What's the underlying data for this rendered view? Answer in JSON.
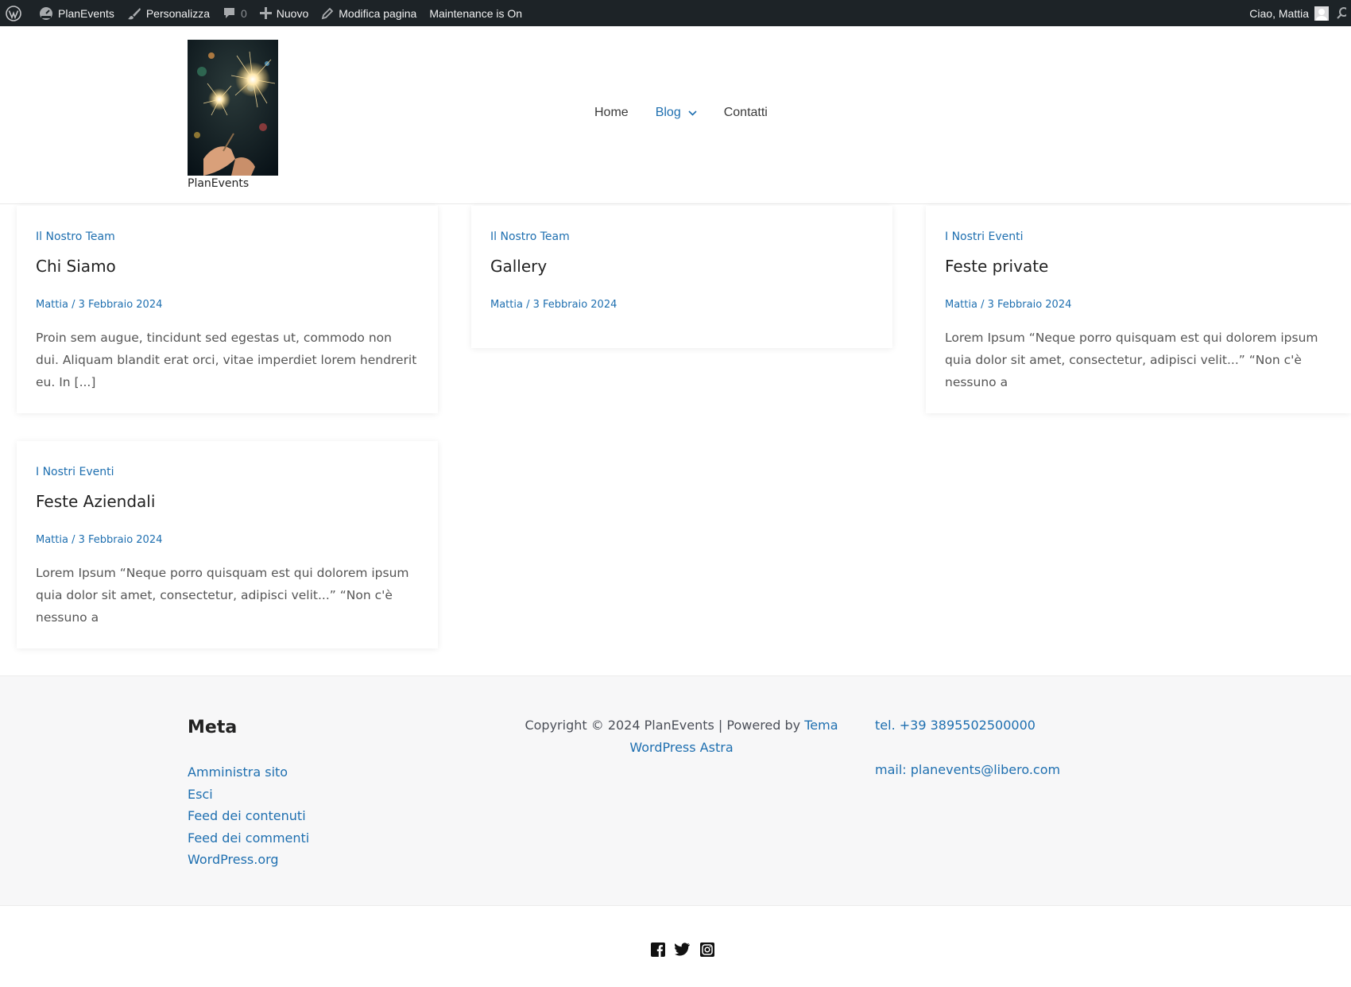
{
  "adminbar": {
    "site_name": "PlanEvents",
    "customize": "Personalizza",
    "comments_count": "0",
    "new": "Nuovo",
    "edit_page": "Modifica pagina",
    "maintenance": "Maintenance is On",
    "greeting": "Ciao, Mattia"
  },
  "header": {
    "site_title": "PlanEvents",
    "nav": {
      "home": "Home",
      "blog": "Blog",
      "contact": "Contatti"
    },
    "logo_image": "sparkler photo"
  },
  "posts": [
    {
      "category": "Il Nostro Team",
      "title": "Chi Siamo",
      "meta": "Mattia / 3 Febbraio 2024",
      "excerpt": "Proin sem augue, tincidunt sed egestas ut, commodo non dui. Aliquam blandit erat orci, vitae imperdiet lorem hendrerit eu. In [...]"
    },
    {
      "category": "Il Nostro Team",
      "title": "Gallery",
      "meta": "Mattia / 3 Febbraio 2024",
      "excerpt": ""
    },
    {
      "category": "I Nostri Eventi",
      "title": "Feste private",
      "meta": "Mattia / 3 Febbraio 2024",
      "excerpt": "Lorem Ipsum “Neque porro quisquam est qui dolorem ipsum quia dolor sit amet, consectetur, adipisci velit...” “Non c'è nessuno a"
    },
    {
      "category": "I Nostri Eventi",
      "title": "Feste Aziendali",
      "meta": "Mattia / 3 Febbraio 2024",
      "excerpt": "Lorem Ipsum “Neque porro quisquam est qui dolorem ipsum quia dolor sit amet, consectetur, adipisci velit...” “Non c'è nessuno a"
    }
  ],
  "footer": {
    "meta_title": "Meta",
    "meta_links": [
      "Amministra sito",
      "Esci",
      "Feed dei contenuti",
      "Feed dei commenti",
      "WordPress.org"
    ],
    "copyright_text": "Copyright © 2024 PlanEvents | Powered by ",
    "copyright_link": "Tema WordPress Astra",
    "phone": "tel. +39 3895502500000",
    "mail": "mail: planevents@libero.com"
  },
  "social_icons": [
    "facebook-icon",
    "twitter-icon",
    "instagram-icon"
  ],
  "colors": {
    "accent": "#1e6fb0",
    "adminbar": "#1d2327",
    "footer_bg": "#f7f7f8"
  }
}
